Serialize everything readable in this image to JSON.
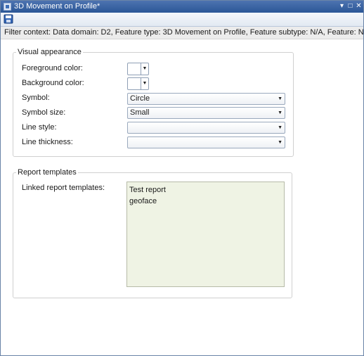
{
  "window": {
    "title": "3D Movement on Profile*",
    "controls": [
      "▾",
      "□",
      "✕"
    ]
  },
  "toolbar": {
    "save_icon": "save-icon"
  },
  "filter_context": "Filter context: Data domain: D2, Feature type: 3D Movement on Profile, Feature subtype: N/A, Feature: N/A",
  "visual_appearance": {
    "legend": "Visual appearance",
    "foreground_label": "Foreground color:",
    "background_label": "Background color:",
    "symbol_label": "Symbol:",
    "symbol_value": "Circle",
    "symbol_size_label": "Symbol size:",
    "symbol_size_value": "Small",
    "line_style_label": "Line style:",
    "line_style_value": "",
    "line_thickness_label": "Line thickness:",
    "line_thickness_value": "",
    "dropdown_arrow": "▼"
  },
  "report_templates": {
    "legend": "Report templates",
    "linked_label": "Linked report templates:",
    "items": [
      "Test report",
      "geoface"
    ]
  }
}
